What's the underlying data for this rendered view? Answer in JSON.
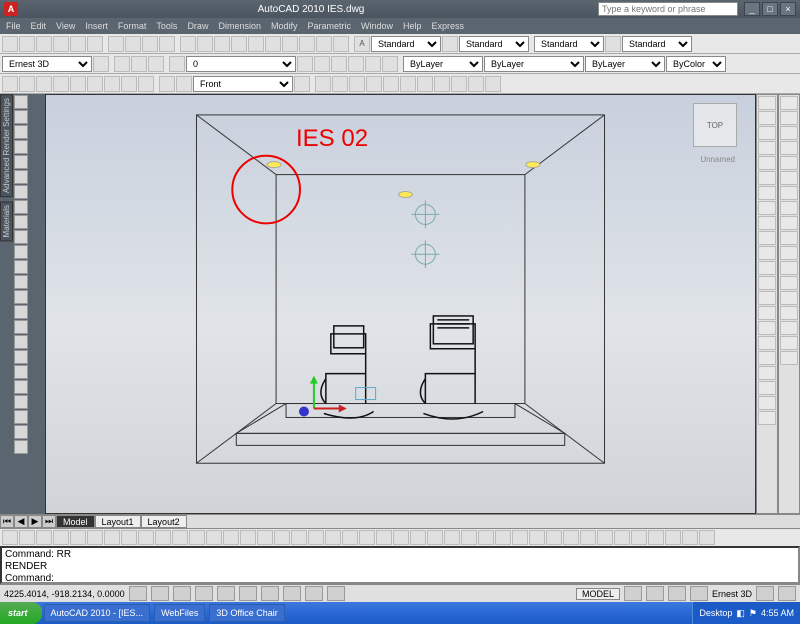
{
  "titlebar": {
    "logo": "A",
    "title": "AutoCAD 2010   IES.dwg",
    "search_placeholder": "Type a keyword or phrase"
  },
  "menu": [
    "File",
    "Edit",
    "View",
    "Insert",
    "Format",
    "Tools",
    "Draw",
    "Dimension",
    "Modify",
    "Parametric",
    "Window",
    "Help",
    "Express"
  ],
  "toolbar2": {
    "workspace": "Ernest 3D",
    "layer": "0",
    "bylayer1": "ByLayer",
    "bylayer2": "ByLayer",
    "bylayer3": "ByLayer",
    "bycolor": "ByColor",
    "std1": "Standard",
    "std2": "Standard",
    "std3": "Standard",
    "std4": "Standard"
  },
  "toolbar3": {
    "view": "Front"
  },
  "left_labels": [
    "Advanced Render Settings",
    "Materials"
  ],
  "viewport": {
    "viewcube": "TOP",
    "unsaved": "Unnamed",
    "annotation": "IES 02"
  },
  "tabs": {
    "active": "Model",
    "layout1": "Layout1",
    "layout2": "Layout2"
  },
  "cmd": {
    "l1": "Command: RR",
    "l2": "RENDER",
    "l3": "Command:"
  },
  "statusbar": {
    "coords": "4225.4014, -918.2134, 0.0000",
    "model": "MODEL",
    "ws": "Ernest 3D"
  },
  "taskbar": {
    "start": "start",
    "t1": "AutoCAD 2010 - [IES...",
    "t2": "WebFiles",
    "t3": "3D Office Chair",
    "tray_desktop": "Desktop",
    "clock": "4:55 AM"
  }
}
